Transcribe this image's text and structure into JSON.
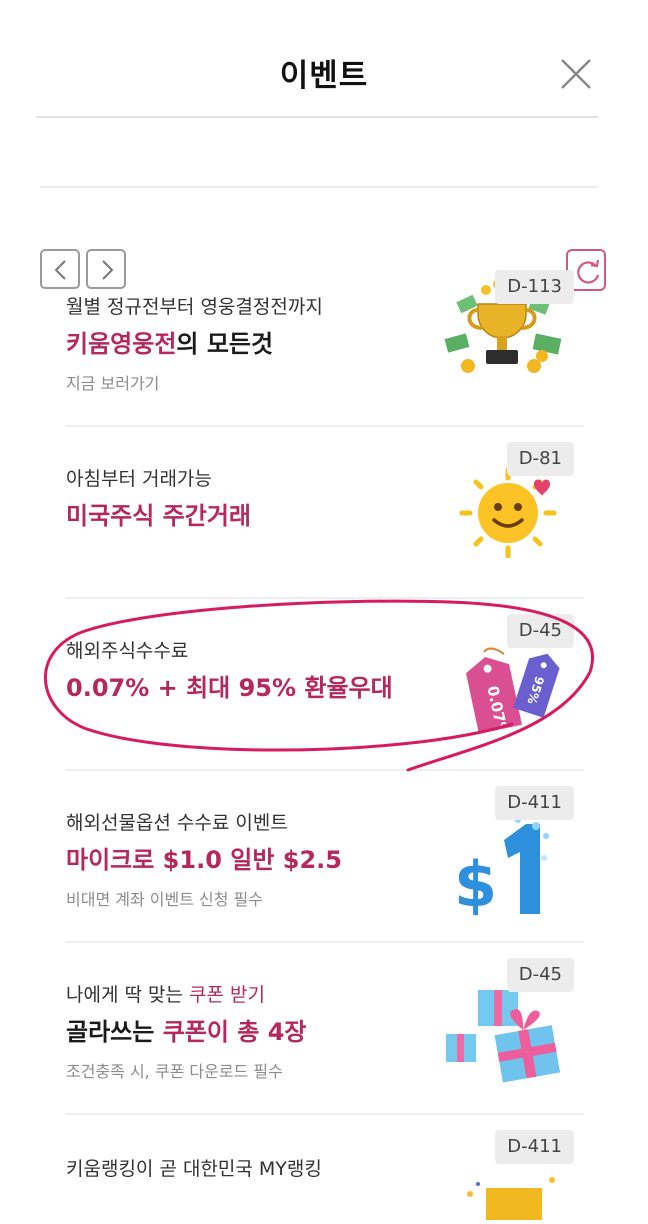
{
  "header": {
    "title": "이벤트",
    "close_icon": "close-icon"
  },
  "toolbar": {
    "prev_icon": "chevron-left-icon",
    "next_icon": "chevron-right-icon",
    "refresh_icon": "refresh-icon"
  },
  "colors": {
    "accent": "#b5275f",
    "circle": "#d81b60"
  },
  "events": [
    {
      "sub": "월별 정규전부터 영웅결정전까지",
      "head_pink": "키움영웅전",
      "head_dark": "의 모든것",
      "note": "지금 보러가기",
      "dday": "D-113",
      "icon": "trophy-icon"
    },
    {
      "sub": "아침부터 거래가능",
      "head_pink": "미국주식 주간거래",
      "dday": "D-81",
      "icon": "smiley-sun-icon"
    },
    {
      "sub": "해외주식수수료",
      "head_pink": "0.07% + 최대 95% 환율우대",
      "dday": "D-45",
      "icon": "price-tag-icon",
      "tag1": "0.07%",
      "tag2": "95%"
    },
    {
      "sub": "해외선물옵션 수수료 이벤트",
      "head_pink": "마이크로 $1.0 일반 $2.5",
      "note": "비대면 계좌 이벤트 신청 필수",
      "dday": "D-411",
      "icon": "dollar-icon"
    },
    {
      "sub_dark": "나에게 딱 맞는 ",
      "sub_pink": "쿠폰 받기",
      "head_dark": "골라쓰는 ",
      "head_pink": "쿠폰이 총 4장",
      "note": "조건충족 시, 쿠폰 다운로드 필수",
      "dday": "D-45",
      "icon": "gift-box-icon"
    },
    {
      "sub": "키움랭킹이 곧 대한민국 MY랭킹",
      "dday": "D-411",
      "icon": "trophy-icon"
    }
  ]
}
